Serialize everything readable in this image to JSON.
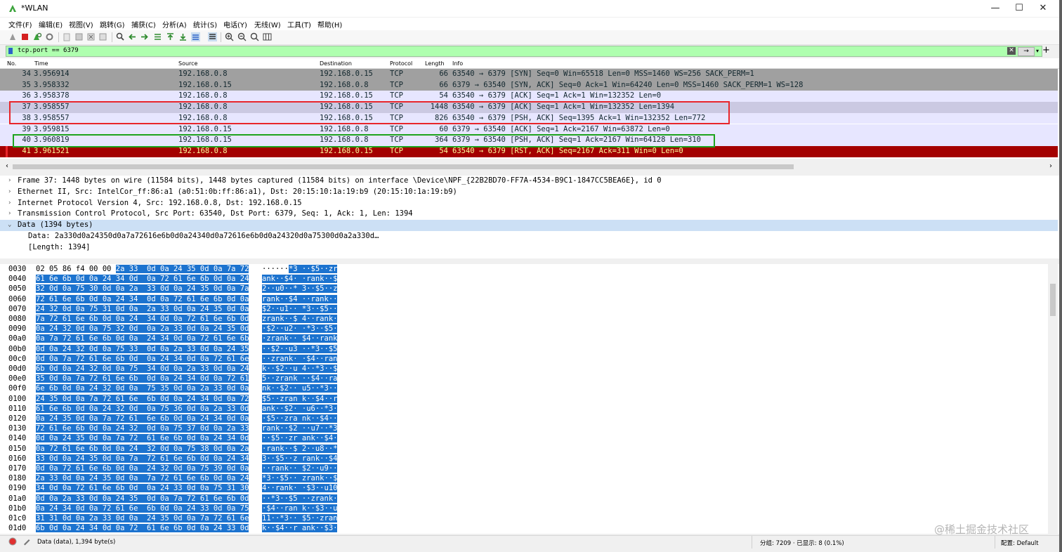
{
  "window": {
    "title": "*WLAN",
    "controls": [
      "—",
      "☐",
      "✕"
    ]
  },
  "menu": [
    "文件(F)",
    "编辑(E)",
    "视图(V)",
    "跳转(G)",
    "捕获(C)",
    "分析(A)",
    "统计(S)",
    "电话(Y)",
    "无线(W)",
    "工具(T)",
    "帮助(H)"
  ],
  "filter": {
    "value": "tcp.port == 6379",
    "apply_label": "→",
    "add_label": "+"
  },
  "packet_list": {
    "columns": [
      "No.",
      "Time",
      "Source",
      "Destination",
      "Protocol",
      "Length",
      "Info"
    ],
    "rows": [
      {
        "no": "34",
        "time": "3.956914",
        "src": "192.168.0.8",
        "dst": "192.168.0.15",
        "proto": "TCP",
        "len": "66",
        "info": "63540 → 6379 [SYN] Seq=0 Win=65518 Len=0 MSS=1460 WS=256 SACK_PERM=1",
        "bg": "#a0a0a0",
        "fg": "#12272e"
      },
      {
        "no": "35",
        "time": "3.958332",
        "src": "192.168.0.15",
        "dst": "192.168.0.8",
        "proto": "TCP",
        "len": "66",
        "info": "6379 → 63540 [SYN, ACK] Seq=0 Ack=1 Win=64240 Len=0 MSS=1460 SACK_PERM=1 WS=128",
        "bg": "#a0a0a0",
        "fg": "#12272e"
      },
      {
        "no": "36",
        "time": "3.958378",
        "src": "192.168.0.8",
        "dst": "192.168.0.15",
        "proto": "TCP",
        "len": "54",
        "info": "63540 → 6379 [ACK] Seq=1 Ack=1 Win=132352 Len=0",
        "bg": "#e7e6ff",
        "fg": "#12272e"
      },
      {
        "no": "37",
        "time": "3.958557",
        "src": "192.168.0.8",
        "dst": "192.168.0.15",
        "proto": "TCP",
        "len": "1448",
        "info": "63540 → 6379 [ACK] Seq=1 Ack=1 Win=132352 Len=1394",
        "bg": "#cbc9e2",
        "fg": "#12272e"
      },
      {
        "no": "38",
        "time": "3.958557",
        "src": "192.168.0.8",
        "dst": "192.168.0.15",
        "proto": "TCP",
        "len": "826",
        "info": "63540 → 6379 [PSH, ACK] Seq=1395 Ack=1 Win=132352 Len=772",
        "bg": "#e7e6ff",
        "fg": "#12272e"
      },
      {
        "no": "39",
        "time": "3.959815",
        "src": "192.168.0.15",
        "dst": "192.168.0.8",
        "proto": "TCP",
        "len": "60",
        "info": "6379 → 63540 [ACK] Seq=1 Ack=2167 Win=63872 Len=0",
        "bg": "#e7e6ff",
        "fg": "#12272e"
      },
      {
        "no": "40",
        "time": "3.960819",
        "src": "192.168.0.15",
        "dst": "192.168.0.8",
        "proto": "TCP",
        "len": "364",
        "info": "6379 → 63540 [PSH, ACK] Seq=1 Ack=2167 Win=64128 Len=310",
        "bg": "#e7e6ff",
        "fg": "#12272e"
      },
      {
        "no": "41",
        "time": "3.961521",
        "src": "192.168.0.8",
        "dst": "192.168.0.15",
        "proto": "TCP",
        "len": "54",
        "info": "63540 → 6379 [RST, ACK] Seq=2167 Ack=311 Win=0 Len=0",
        "bg": "#a40000",
        "fg": "#fffc9c"
      }
    ]
  },
  "details": [
    {
      "arrow": "›",
      "text": "Frame 37: 1448 bytes on wire (11584 bits), 1448 bytes captured (11584 bits) on interface \\Device\\NPF_{22B2BD70-FF7A-4534-B9C1-1847CC5BEA6E}, id 0",
      "indent": 0,
      "selected": false
    },
    {
      "arrow": "›",
      "text": "Ethernet II, Src: IntelCor_ff:86:a1 (a0:51:0b:ff:86:a1), Dst: 20:15:10:1a:19:b9 (20:15:10:1a:19:b9)",
      "indent": 0,
      "selected": false
    },
    {
      "arrow": "›",
      "text": "Internet Protocol Version 4, Src: 192.168.0.8, Dst: 192.168.0.15",
      "indent": 0,
      "selected": false
    },
    {
      "arrow": "›",
      "text": "Transmission Control Protocol, Src Port: 63540, Dst Port: 6379, Seq: 1, Ack: 1, Len: 1394",
      "indent": 0,
      "selected": false
    },
    {
      "arrow": "⌄",
      "text": "Data (1394 bytes)",
      "indent": 0,
      "selected": true
    },
    {
      "arrow": "",
      "text": "Data: 2a330d0a24350d0a7a72616e6b0d0a24340d0a72616e6b0d0a24320d0a75300d0a2a330d…",
      "indent": 1,
      "selected": false
    },
    {
      "arrow": "",
      "text": "[Length: 1394]",
      "indent": 1,
      "selected": false
    }
  ],
  "bytes": [
    {
      "off": "0030",
      "pre": "02 05 86 f4 00 00 ",
      "hex": "2a 33  0d 0a 24 35 0d 0a 7a 72",
      "apre": "······",
      "ascii": "*3 ··$5··zr"
    },
    {
      "off": "0040",
      "pre": "",
      "hex": "61 6e 6b 0d 0a 24 34 0d  0a 72 61 6e 6b 0d 0a 24",
      "apre": "",
      "ascii": "ank··$4· ·rank··$"
    },
    {
      "off": "0050",
      "pre": "",
      "hex": "32 0d 0a 75 30 0d 0a 2a  33 0d 0a 24 35 0d 0a 7a",
      "apre": "",
      "ascii": "2··u0··* 3··$5··z"
    },
    {
      "off": "0060",
      "pre": "",
      "hex": "72 61 6e 6b 0d 0a 24 34  0d 0a 72 61 6e 6b 0d 0a",
      "apre": "",
      "ascii": "rank··$4 ··rank··"
    },
    {
      "off": "0070",
      "pre": "",
      "hex": "24 32 0d 0a 75 31 0d 0a  2a 33 0d 0a 24 35 0d 0a",
      "apre": "",
      "ascii": "$2··u1·· *3··$5··"
    },
    {
      "off": "0080",
      "pre": "",
      "hex": "7a 72 61 6e 6b 0d 0a 24  34 0d 0a 72 61 6e 6b 0d",
      "apre": "",
      "ascii": "zrank··$ 4··rank·"
    },
    {
      "off": "0090",
      "pre": "",
      "hex": "0a 24 32 0d 0a 75 32 0d  0a 2a 33 0d 0a 24 35 0d",
      "apre": "",
      "ascii": "·$2··u2· ·*3··$5·"
    },
    {
      "off": "00a0",
      "pre": "",
      "hex": "0a 7a 72 61 6e 6b 0d 0a  24 34 0d 0a 72 61 6e 6b",
      "apre": "",
      "ascii": "·zrank·· $4··rank"
    },
    {
      "off": "00b0",
      "pre": "",
      "hex": "0d 0a 24 32 0d 0a 75 33  0d 0a 2a 33 0d 0a 24 35",
      "apre": "",
      "ascii": "··$2··u3 ··*3··$5"
    },
    {
      "off": "00c0",
      "pre": "",
      "hex": "0d 0a 7a 72 61 6e 6b 0d  0a 24 34 0d 0a 72 61 6e",
      "apre": "",
      "ascii": "··zrank· ·$4··ran"
    },
    {
      "off": "00d0",
      "pre": "",
      "hex": "6b 0d 0a 24 32 0d 0a 75  34 0d 0a 2a 33 0d 0a 24",
      "apre": "",
      "ascii": "k··$2··u 4··*3··$"
    },
    {
      "off": "00e0",
      "pre": "",
      "hex": "35 0d 0a 7a 72 61 6e 6b  0d 0a 24 34 0d 0a 72 61",
      "apre": "",
      "ascii": "5··zrank ··$4··ra"
    },
    {
      "off": "00f0",
      "pre": "",
      "hex": "6e 6b 0d 0a 24 32 0d 0a  75 35 0d 0a 2a 33 0d 0a",
      "apre": "",
      "ascii": "nk··$2·· u5··*3··"
    },
    {
      "off": "0100",
      "pre": "",
      "hex": "24 35 0d 0a 7a 72 61 6e  6b 0d 0a 24 34 0d 0a 72",
      "apre": "",
      "ascii": "$5··zran k··$4··r"
    },
    {
      "off": "0110",
      "pre": "",
      "hex": "61 6e 6b 0d 0a 24 32 0d  0a 75 36 0d 0a 2a 33 0d",
      "apre": "",
      "ascii": "ank··$2· ·u6··*3·"
    },
    {
      "off": "0120",
      "pre": "",
      "hex": "0a 24 35 0d 0a 7a 72 61  6e 6b 0d 0a 24 34 0d 0a",
      "apre": "",
      "ascii": "·$5··zra nk··$4··"
    },
    {
      "off": "0130",
      "pre": "",
      "hex": "72 61 6e 6b 0d 0a 24 32  0d 0a 75 37 0d 0a 2a 33",
      "apre": "",
      "ascii": "rank··$2 ··u7··*3"
    },
    {
      "off": "0140",
      "pre": "",
      "hex": "0d 0a 24 35 0d 0a 7a 72  61 6e 6b 0d 0a 24 34 0d",
      "apre": "",
      "ascii": "··$5··zr ank··$4·"
    },
    {
      "off": "0150",
      "pre": "",
      "hex": "0a 72 61 6e 6b 0d 0a 24  32 0d 0a 75 38 0d 0a 2a",
      "apre": "",
      "ascii": "·rank··$ 2··u8··*"
    },
    {
      "off": "0160",
      "pre": "",
      "hex": "33 0d 0a 24 35 0d 0a 7a  72 61 6e 6b 0d 0a 24 34",
      "apre": "",
      "ascii": "3··$5··z rank··$4"
    },
    {
      "off": "0170",
      "pre": "",
      "hex": "0d 0a 72 61 6e 6b 0d 0a  24 32 0d 0a 75 39 0d 0a",
      "apre": "",
      "ascii": "··rank·· $2··u9··"
    },
    {
      "off": "0180",
      "pre": "",
      "hex": "2a 33 0d 0a 24 35 0d 0a  7a 72 61 6e 6b 0d 0a 24",
      "apre": "",
      "ascii": "*3··$5·· zrank··$"
    },
    {
      "off": "0190",
      "pre": "",
      "hex": "34 0d 0a 72 61 6e 6b 0d  0a 24 33 0d 0a 75 31 30",
      "apre": "",
      "ascii": "4··rank· ·$3··u10"
    },
    {
      "off": "01a0",
      "pre": "",
      "hex": "0d 0a 2a 33 0d 0a 24 35  0d 0a 7a 72 61 6e 6b 0d",
      "apre": "",
      "ascii": "··*3··$5 ··zrank·"
    },
    {
      "off": "01b0",
      "pre": "",
      "hex": "0a 24 34 0d 0a 72 61 6e  6b 0d 0a 24 33 0d 0a 75",
      "apre": "",
      "ascii": "·$4··ran k··$3··u"
    },
    {
      "off": "01c0",
      "pre": "",
      "hex": "31 31 0d 0a 2a 33 0d 0a  24 35 0d 0a 7a 72 61 6e",
      "apre": "",
      "ascii": "11··*3·· $5··zran"
    },
    {
      "off": "01d0",
      "pre": "",
      "hex": "6b 0d 0a 24 34 0d 0a 72  61 6e 6b 0d 0a 24 33 0d",
      "apre": "",
      "ascii": "k··$4··r ank··$3·"
    }
  ],
  "status": {
    "field": "Data (data), 1,394 byte(s)",
    "packets": "分组: 7209 · 已显示: 8 (0.1%)",
    "profile": "配置: Default"
  },
  "watermark": "@稀土掘金技术社区",
  "ghost_text": "e",
  "colors": {
    "accent_selection": "#1c73cf",
    "red_box": "#e8262b",
    "green_box": "#1ea31e",
    "filter_ok": "#afffaf"
  }
}
